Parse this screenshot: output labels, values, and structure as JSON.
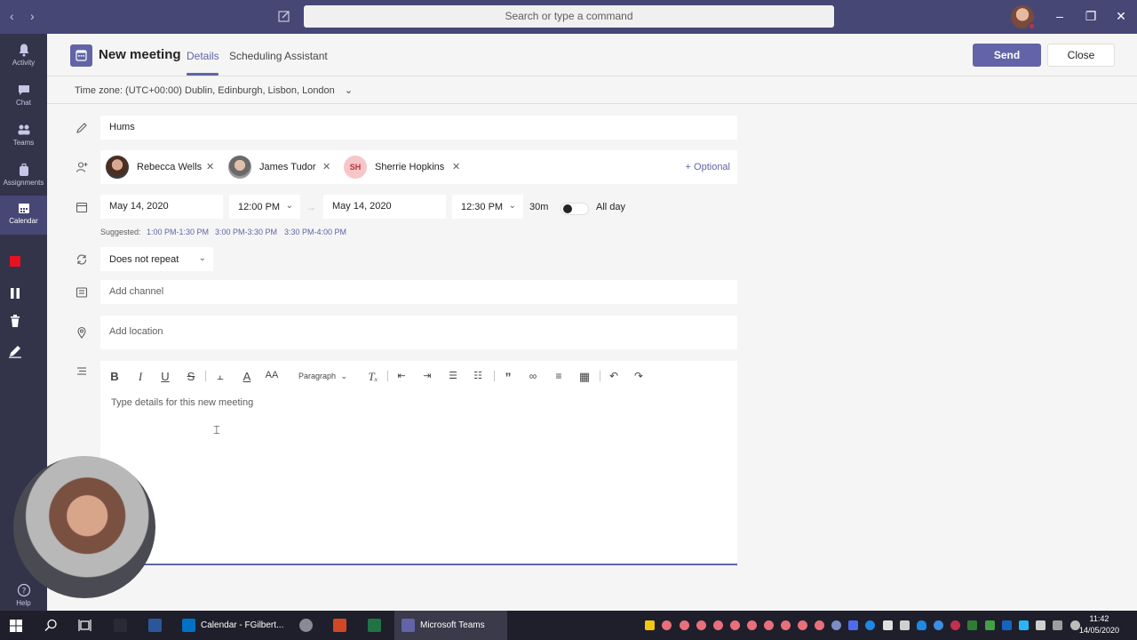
{
  "search": {
    "placeholder": "Search or type a command"
  },
  "rail": {
    "items": [
      {
        "label": "Activity"
      },
      {
        "label": "Chat"
      },
      {
        "label": "Teams"
      },
      {
        "label": "Assignments"
      },
      {
        "label": "Calendar"
      },
      {
        "label": "Help"
      }
    ]
  },
  "header": {
    "title": "New meeting",
    "tabs": [
      {
        "label": "Details"
      },
      {
        "label": "Scheduling Assistant"
      }
    ],
    "send_label": "Send",
    "close_label": "Close"
  },
  "timezone": "Time zone: (UTC+00:00) Dublin, Edinburgh, Lisbon, London",
  "form": {
    "title_value": "Hums",
    "attendees": [
      {
        "name": "Rebecca Wells"
      },
      {
        "name": "James Tudor"
      },
      {
        "name": "Sherrie Hopkins",
        "initials": "SH"
      }
    ],
    "optional_label": "+ Optional",
    "start_date": "May 14, 2020",
    "start_time": "12:00 PM",
    "end_date": "May 14, 2020",
    "end_time": "12:30 PM",
    "duration": "30m",
    "all_day_label": "All day",
    "suggested_label": "Suggested:",
    "suggested_slots": [
      "1:00 PM-1:30 PM",
      "3:00 PM-3:30 PM",
      "3:30 PM-4:00 PM"
    ],
    "repeat_value": "Does not repeat",
    "channel_placeholder": "Add channel",
    "location_placeholder": "Add location",
    "paragraph_label": "Paragraph",
    "details_placeholder": "Type details for this new meeting"
  },
  "taskbar": {
    "apps": [
      {
        "label": "Calendar - FGilbert..."
      },
      {
        "label": "Microsoft Teams"
      }
    ],
    "time": "11:42",
    "date": "14/05/2020"
  },
  "colors": {
    "accent": "#6264a7",
    "titlebar": "#464775",
    "rail": "#33344a"
  }
}
